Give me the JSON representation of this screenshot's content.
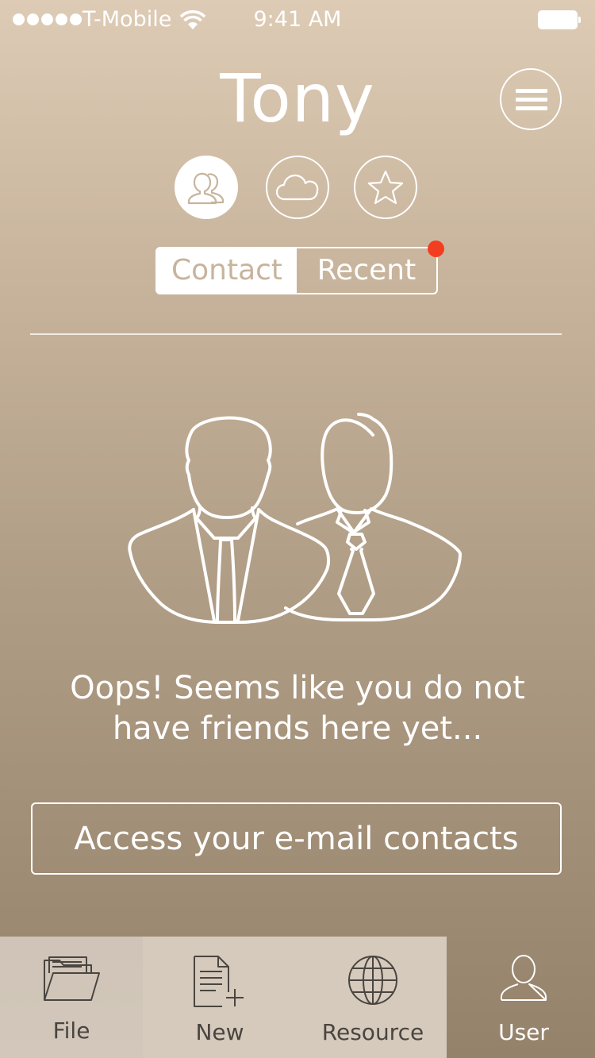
{
  "status_bar": {
    "carrier": "T-Mobile",
    "time": "9:41 AM",
    "signal_dots": 5
  },
  "header": {
    "user_name": "Tony"
  },
  "icon_buttons": [
    {
      "icon": "contacts-icon",
      "active": true
    },
    {
      "icon": "cloud-icon",
      "active": false
    },
    {
      "icon": "star-icon",
      "active": false
    }
  ],
  "segmented": {
    "contact_label": "Contact",
    "recent_label": "Recent",
    "active": "Contact",
    "recent_has_notification": true
  },
  "empty_state": {
    "line1": "Oops! Seems like you do not",
    "line2": "have friends here yet..."
  },
  "cta": {
    "label": "Access your e-mail contacts"
  },
  "tab_bar": {
    "tabs": [
      {
        "label": "File",
        "icon": "folder-icon"
      },
      {
        "label": "New",
        "icon": "new-document-icon"
      },
      {
        "label": "Resource",
        "icon": "globe-icon"
      },
      {
        "label": "User",
        "icon": "user-icon"
      }
    ],
    "active": "User"
  },
  "colors": {
    "accent_text": "#c7b49c",
    "badge": "#f33d20",
    "tab_bar_light": "#d6cabd",
    "tab_label": "#4a4540"
  }
}
